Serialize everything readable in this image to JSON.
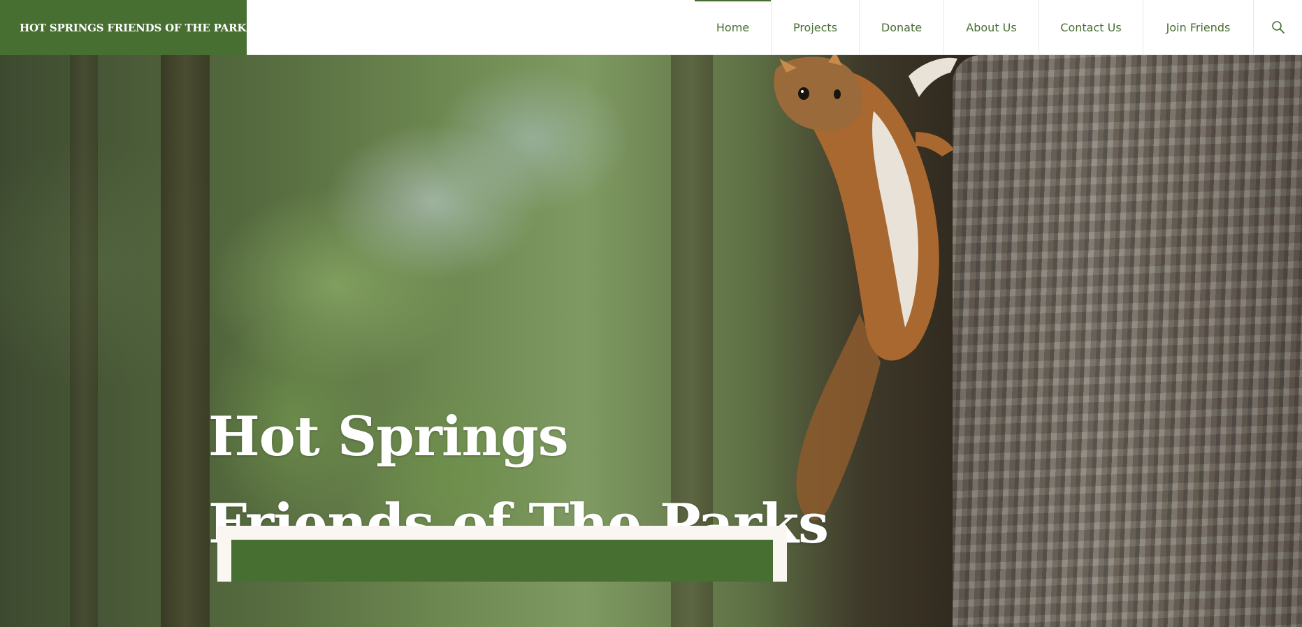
{
  "site": {
    "logo_text": "HOT SPRINGS FRIENDS OF THE PARKS"
  },
  "nav": {
    "items": [
      {
        "label": "Home",
        "active": true
      },
      {
        "label": "Projects",
        "active": false
      },
      {
        "label": "Donate",
        "active": false
      },
      {
        "label": "About Us",
        "active": false
      },
      {
        "label": "Contact Us",
        "active": false
      },
      {
        "label": "Join Friends",
        "active": false
      }
    ],
    "search_icon": "search-icon"
  },
  "hero": {
    "title_line1": "Hot Springs",
    "title_line2": "Friends of The Parks",
    "image": "squirrel-on-tree-photo"
  },
  "colors": {
    "brand_green": "#476f31",
    "white": "#ffffff",
    "cta_frame": "#faf6f2"
  }
}
